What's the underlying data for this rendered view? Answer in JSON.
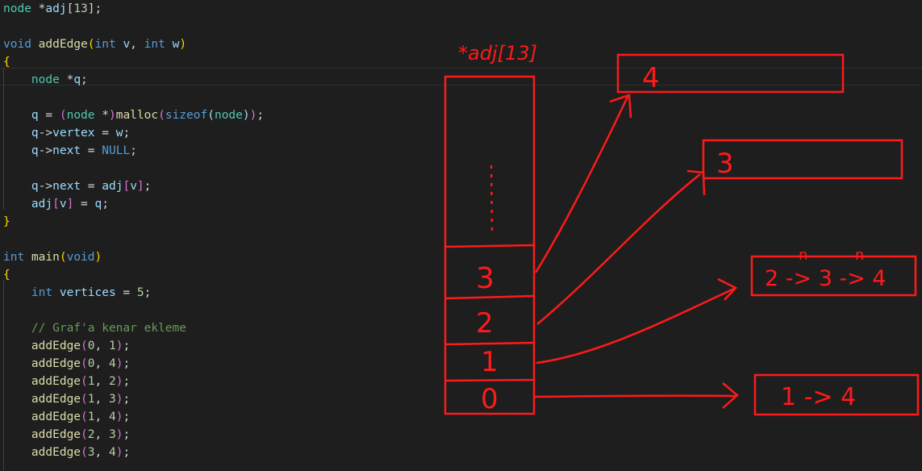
{
  "colors": {
    "background": "#1e1e1e",
    "keyword": "#569cd6",
    "function": "#dcdcaa",
    "variable": "#9cdcfe",
    "type": "#4ec9b0",
    "number": "#b5cea8",
    "brace": "#ffd700",
    "paren": "#da70d6",
    "comment": "#6a9955",
    "ink": "#ff1a1a"
  },
  "code": {
    "lines": [
      [
        {
          "t": "node",
          "c": "type"
        },
        {
          "t": " *",
          "c": "plain"
        },
        {
          "t": "adj",
          "c": "var"
        },
        {
          "t": "[",
          "c": "plain"
        },
        {
          "t": "13",
          "c": "num"
        },
        {
          "t": "];",
          "c": "plain"
        }
      ],
      [],
      [
        {
          "t": "void",
          "c": "kw"
        },
        {
          "t": " ",
          "c": "plain"
        },
        {
          "t": "addEdge",
          "c": "fn"
        },
        {
          "t": "(",
          "c": "brace"
        },
        {
          "t": "int",
          "c": "kw"
        },
        {
          "t": " ",
          "c": "plain"
        },
        {
          "t": "v",
          "c": "var"
        },
        {
          "t": ", ",
          "c": "plain"
        },
        {
          "t": "int",
          "c": "kw"
        },
        {
          "t": " ",
          "c": "plain"
        },
        {
          "t": "w",
          "c": "var"
        },
        {
          "t": ")",
          "c": "brace"
        }
      ],
      [
        {
          "t": "{",
          "c": "brace"
        }
      ],
      [
        {
          "t": "    ",
          "c": "plain"
        },
        {
          "t": "node",
          "c": "type"
        },
        {
          "t": " *",
          "c": "plain"
        },
        {
          "t": "q",
          "c": "var"
        },
        {
          "t": ";",
          "c": "plain"
        }
      ],
      [],
      [
        {
          "t": "    ",
          "c": "plain"
        },
        {
          "t": "q",
          "c": "var"
        },
        {
          "t": " = ",
          "c": "plain"
        },
        {
          "t": "(",
          "c": "paren"
        },
        {
          "t": "node",
          "c": "type"
        },
        {
          "t": " *",
          "c": "plain"
        },
        {
          "t": ")",
          "c": "paren"
        },
        {
          "t": "malloc",
          "c": "fn"
        },
        {
          "t": "(",
          "c": "paren"
        },
        {
          "t": "sizeof",
          "c": "kw"
        },
        {
          "t": "(",
          "c": "var"
        },
        {
          "t": "node",
          "c": "type"
        },
        {
          "t": ")",
          "c": "var"
        },
        {
          "t": ")",
          "c": "paren"
        },
        {
          "t": ";",
          "c": "plain"
        }
      ],
      [
        {
          "t": "    ",
          "c": "plain"
        },
        {
          "t": "q",
          "c": "var"
        },
        {
          "t": "->",
          "c": "plain"
        },
        {
          "t": "vertex",
          "c": "var"
        },
        {
          "t": " = ",
          "c": "plain"
        },
        {
          "t": "w",
          "c": "var"
        },
        {
          "t": ";",
          "c": "plain"
        }
      ],
      [
        {
          "t": "    ",
          "c": "plain"
        },
        {
          "t": "q",
          "c": "var"
        },
        {
          "t": "->",
          "c": "plain"
        },
        {
          "t": "next",
          "c": "var"
        },
        {
          "t": " = ",
          "c": "plain"
        },
        {
          "t": "NULL",
          "c": "kw"
        },
        {
          "t": ";",
          "c": "plain"
        }
      ],
      [],
      [
        {
          "t": "    ",
          "c": "plain"
        },
        {
          "t": "q",
          "c": "var"
        },
        {
          "t": "->",
          "c": "plain"
        },
        {
          "t": "next",
          "c": "var"
        },
        {
          "t": " = ",
          "c": "plain"
        },
        {
          "t": "adj",
          "c": "var"
        },
        {
          "t": "[",
          "c": "paren"
        },
        {
          "t": "v",
          "c": "var"
        },
        {
          "t": "]",
          "c": "paren"
        },
        {
          "t": ";",
          "c": "plain"
        }
      ],
      [
        {
          "t": "    ",
          "c": "plain"
        },
        {
          "t": "adj",
          "c": "var"
        },
        {
          "t": "[",
          "c": "paren"
        },
        {
          "t": "v",
          "c": "var"
        },
        {
          "t": "]",
          "c": "paren"
        },
        {
          "t": " = ",
          "c": "plain"
        },
        {
          "t": "q",
          "c": "var"
        },
        {
          "t": ";",
          "c": "plain"
        }
      ],
      [
        {
          "t": "}",
          "c": "brace"
        }
      ],
      [],
      [
        {
          "t": "int",
          "c": "kw"
        },
        {
          "t": " ",
          "c": "plain"
        },
        {
          "t": "main",
          "c": "fn"
        },
        {
          "t": "(",
          "c": "brace"
        },
        {
          "t": "void",
          "c": "kw"
        },
        {
          "t": ")",
          "c": "brace"
        }
      ],
      [
        {
          "t": "{",
          "c": "brace"
        }
      ],
      [
        {
          "t": "    ",
          "c": "plain"
        },
        {
          "t": "int",
          "c": "kw"
        },
        {
          "t": " ",
          "c": "plain"
        },
        {
          "t": "vertices",
          "c": "var"
        },
        {
          "t": " = ",
          "c": "plain"
        },
        {
          "t": "5",
          "c": "num"
        },
        {
          "t": ";",
          "c": "plain"
        }
      ],
      [],
      [
        {
          "t": "    ",
          "c": "plain"
        },
        {
          "t": "// Graf'a kenar ekleme",
          "c": "cmt"
        }
      ],
      [
        {
          "t": "    ",
          "c": "plain"
        },
        {
          "t": "addEdge",
          "c": "fn"
        },
        {
          "t": "(",
          "c": "paren"
        },
        {
          "t": "0",
          "c": "num"
        },
        {
          "t": ", ",
          "c": "plain"
        },
        {
          "t": "1",
          "c": "num"
        },
        {
          "t": ")",
          "c": "paren"
        },
        {
          "t": ";",
          "c": "plain"
        }
      ],
      [
        {
          "t": "    ",
          "c": "plain"
        },
        {
          "t": "addEdge",
          "c": "fn"
        },
        {
          "t": "(",
          "c": "paren"
        },
        {
          "t": "0",
          "c": "num"
        },
        {
          "t": ", ",
          "c": "plain"
        },
        {
          "t": "4",
          "c": "num"
        },
        {
          "t": ")",
          "c": "paren"
        },
        {
          "t": ";",
          "c": "plain"
        }
      ],
      [
        {
          "t": "    ",
          "c": "plain"
        },
        {
          "t": "addEdge",
          "c": "fn"
        },
        {
          "t": "(",
          "c": "paren"
        },
        {
          "t": "1",
          "c": "num"
        },
        {
          "t": ", ",
          "c": "plain"
        },
        {
          "t": "2",
          "c": "num"
        },
        {
          "t": ")",
          "c": "paren"
        },
        {
          "t": ";",
          "c": "plain"
        }
      ],
      [
        {
          "t": "    ",
          "c": "plain"
        },
        {
          "t": "addEdge",
          "c": "fn"
        },
        {
          "t": "(",
          "c": "paren"
        },
        {
          "t": "1",
          "c": "num"
        },
        {
          "t": ", ",
          "c": "plain"
        },
        {
          "t": "3",
          "c": "num"
        },
        {
          "t": ")",
          "c": "paren"
        },
        {
          "t": ";",
          "c": "plain"
        }
      ],
      [
        {
          "t": "    ",
          "c": "plain"
        },
        {
          "t": "addEdge",
          "c": "fn"
        },
        {
          "t": "(",
          "c": "paren"
        },
        {
          "t": "1",
          "c": "num"
        },
        {
          "t": ", ",
          "c": "plain"
        },
        {
          "t": "4",
          "c": "num"
        },
        {
          "t": ")",
          "c": "paren"
        },
        {
          "t": ";",
          "c": "plain"
        }
      ],
      [
        {
          "t": "    ",
          "c": "plain"
        },
        {
          "t": "addEdge",
          "c": "fn"
        },
        {
          "t": "(",
          "c": "paren"
        },
        {
          "t": "2",
          "c": "num"
        },
        {
          "t": ", ",
          "c": "plain"
        },
        {
          "t": "3",
          "c": "num"
        },
        {
          "t": ")",
          "c": "paren"
        },
        {
          "t": ";",
          "c": "plain"
        }
      ],
      [
        {
          "t": "    ",
          "c": "plain"
        },
        {
          "t": "addEdge",
          "c": "fn"
        },
        {
          "t": "(",
          "c": "paren"
        },
        {
          "t": "3",
          "c": "num"
        },
        {
          "t": ", ",
          "c": "plain"
        },
        {
          "t": "4",
          "c": "num"
        },
        {
          "t": ")",
          "c": "paren"
        },
        {
          "t": ";",
          "c": "plain"
        }
      ]
    ]
  },
  "annotation": {
    "array_label": "*adj[13]",
    "array_cells": [
      "3",
      "2",
      "1",
      "0"
    ],
    "list_boxes": [
      "4",
      "3",
      "2 -> 3 -> 4",
      "1 -> 4"
    ],
    "small_marks": [
      "n",
      "n"
    ]
  }
}
